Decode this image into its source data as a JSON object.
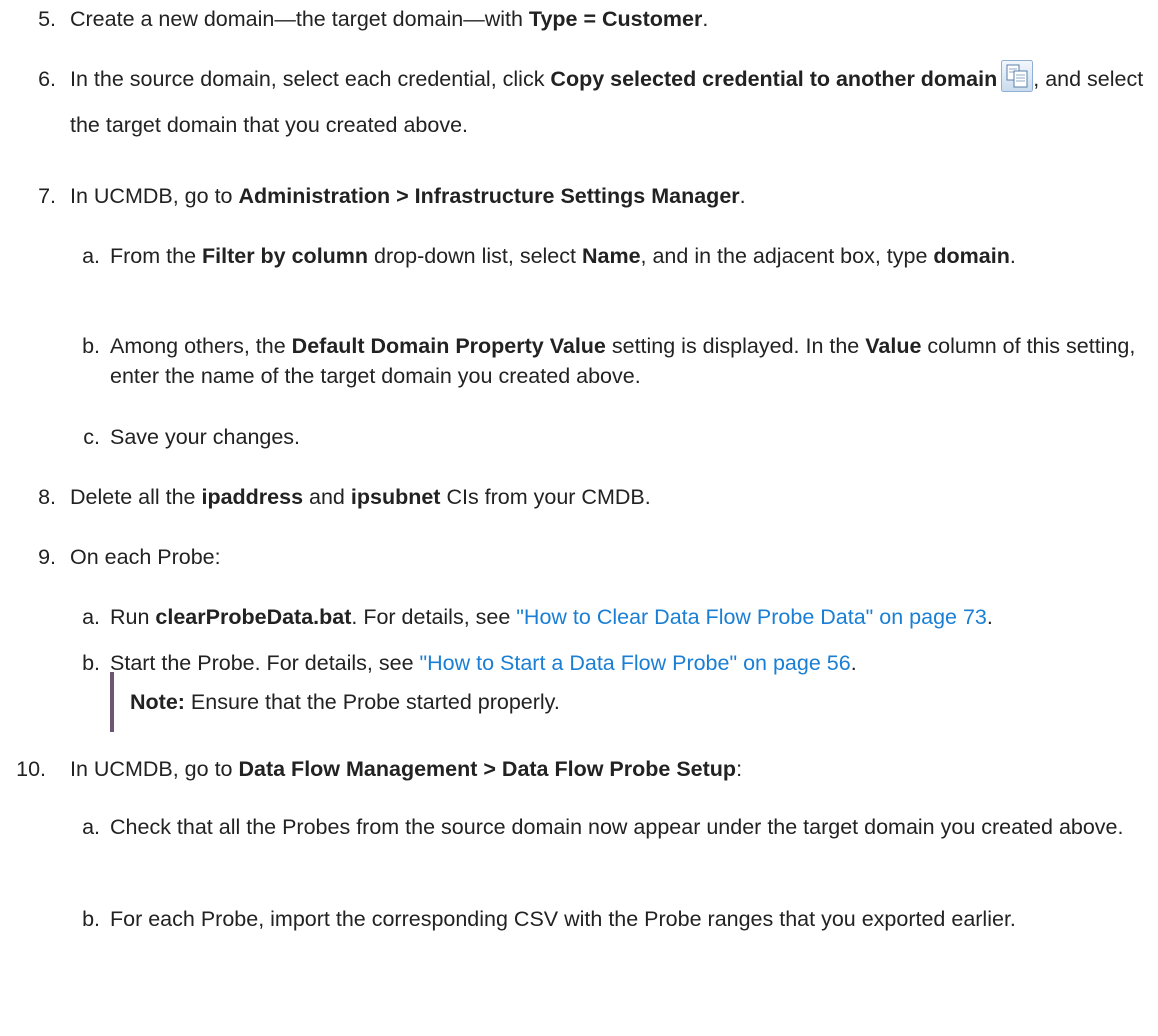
{
  "steps": {
    "s5": {
      "num": "5.",
      "t1": "Create a new domain—the target domain—with ",
      "b1": "Type = Customer",
      "t2": "."
    },
    "s6": {
      "num": "6.",
      "t1": "In the source domain, select each credential, click ",
      "b1": "Copy selected credential to another domain",
      "t2": ", and select the target domain that you created above."
    },
    "s7": {
      "num": "7.",
      "t1": "In UCMDB, go to ",
      "b1": "Administration > Infrastructure Settings Manager",
      "t2": ".",
      "a": {
        "letter": "a.",
        "t1": "From the ",
        "b1": "Filter by column",
        "t2": " drop-down list, select ",
        "b2": "Name",
        "t3": ", and in the adjacent box, type ",
        "b3": "domain",
        "t4": "."
      },
      "b": {
        "letter": "b.",
        "t1": "Among others, the ",
        "b1": "Default Domain Property Value",
        "t2": " setting is displayed. In the ",
        "b2": "Value",
        "t3": " column of this setting, enter the name of the target domain you created above."
      },
      "c": {
        "letter": "c.",
        "t1": "Save your changes."
      }
    },
    "s8": {
      "num": "8.",
      "t1": "Delete all the ",
      "b1": "ipaddress",
      "t2": " and ",
      "b2": "ipsubnet",
      "t3": " CIs from your CMDB."
    },
    "s9": {
      "num": "9.",
      "t1": "On each Probe:",
      "a": {
        "letter": "a.",
        "t1": "Run ",
        "b1": "clearProbeData.bat",
        "t2": ". For details, see ",
        "link": "\"How to Clear Data Flow Probe Data\" on page 73",
        "t3": "."
      },
      "b": {
        "letter": "b.",
        "t1": "Start the Probe. For details, see ",
        "link": "\"How to Start a Data Flow Probe\" on page 56",
        "t2": "."
      },
      "note": {
        "label": "Note:",
        "text": " Ensure that the Probe started properly."
      }
    },
    "s10": {
      "num": "10.",
      "t1": "In UCMDB, go to ",
      "b1": "Data Flow Management > Data Flow Probe Setup",
      "t2": ":",
      "a": {
        "letter": "a.",
        "t1": "Check that all the Probes from the source domain now appear under the target domain you created above."
      },
      "b": {
        "letter": "b.",
        "t1": "For each Probe, import the corresponding CSV with the Probe ranges that you exported earlier."
      }
    }
  },
  "icons": {
    "copy_credential": "copy-credential-icon"
  },
  "colors": {
    "text": "#222222",
    "link": "#1a7fd4",
    "note_bar": "#6e5475"
  }
}
